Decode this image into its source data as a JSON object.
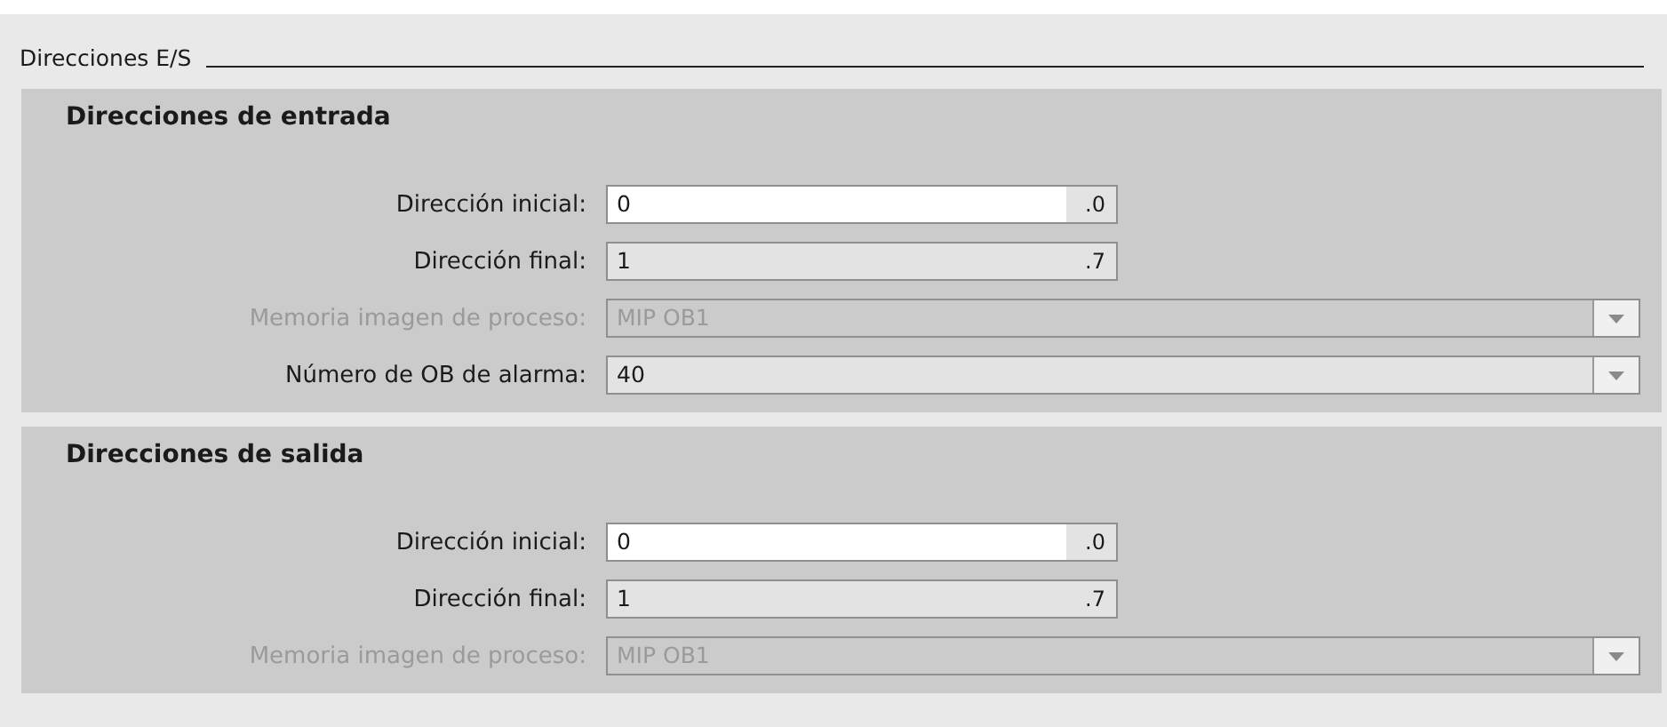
{
  "header": {
    "title": "Direcciones E/S"
  },
  "sections": [
    {
      "title": "Direcciones de entrada",
      "rows": [
        {
          "label": "Dirección inicial:",
          "kind": "address",
          "value": "0",
          "suffix": ".0",
          "editable": true,
          "disabled": false
        },
        {
          "label": "Dirección final:",
          "kind": "address",
          "value": "1",
          "suffix": ".7",
          "editable": false,
          "disabled": false
        },
        {
          "label": "Memoria imagen de proceso:",
          "kind": "dropdown",
          "value": "MIP OB1",
          "disabled": true
        },
        {
          "label": "Número de OB de alarma:",
          "kind": "dropdown",
          "value": "40",
          "disabled": false
        }
      ]
    },
    {
      "title": "Direcciones de salida",
      "rows": [
        {
          "label": "Dirección inicial:",
          "kind": "address",
          "value": "0",
          "suffix": ".0",
          "editable": true,
          "disabled": false
        },
        {
          "label": "Dirección final:",
          "kind": "address",
          "value": "1",
          "suffix": ".7",
          "editable": false,
          "disabled": false
        },
        {
          "label": "Memoria imagen de proceso:",
          "kind": "dropdown",
          "value": "MIP OB1",
          "disabled": true
        }
      ]
    }
  ]
}
